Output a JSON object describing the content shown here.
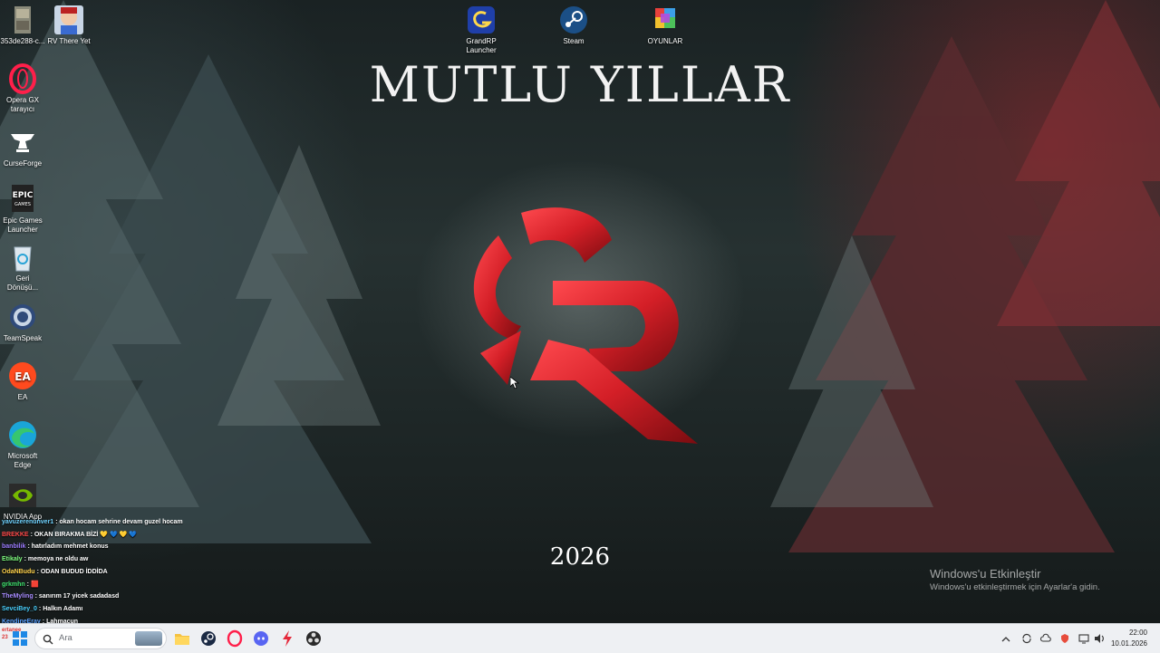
{
  "desktop": {
    "title": "MUTLU YILLAR",
    "year": "2026",
    "icons_left": [
      {
        "name": "file-icon",
        "label": "353de288-c..."
      },
      {
        "name": "rv-there-yet-icon",
        "label": "RV There Yet"
      },
      {
        "name": "opera-gx-icon",
        "label": "Opera GX\ntarayıcı"
      },
      {
        "name": "curseforge-icon",
        "label": "CurseForge"
      },
      {
        "name": "epic-games-icon",
        "label": "Epic Games\nLauncher"
      },
      {
        "name": "recycle-bin-icon",
        "label": "Geri\nDönüşü..."
      },
      {
        "name": "teamspeak-icon",
        "label": "TeamSpeak"
      },
      {
        "name": "ea-icon",
        "label": "EA"
      },
      {
        "name": "edge-icon",
        "label": "Microsoft\nEdge"
      },
      {
        "name": "nvidia-icon",
        "label": "NVIDIA App"
      }
    ],
    "icons_top": [
      {
        "name": "grandrp-icon",
        "label": "GrandRP\nLauncher"
      },
      {
        "name": "steam-icon",
        "label": "Steam"
      },
      {
        "name": "oyunlar-icon",
        "label": "OYUNLAR"
      }
    ]
  },
  "watermark": {
    "line1": "Windows'u Etkinleştir",
    "line2": "Windows'u etkinleştirmek için Ayarlar'a gidin."
  },
  "chat": [
    {
      "user": "yavuzerenunver1",
      "text": ": okan hocam sehrine devam guzel hocam",
      "color": "#6fd3ff"
    },
    {
      "user": "BREKKE",
      "text": ": OKAN BIRAKMA BİZİ 💛 💙 💛 💙",
      "color": "#ff4a4a"
    },
    {
      "user": "banbilik",
      "text": ": hatırladım mehmet konus",
      "color": "#9c7bff"
    },
    {
      "user": "Etikaly",
      "text": ": memoya ne oldu aw",
      "color": "#7fff7f"
    },
    {
      "user": "OdaNBudu",
      "text": ": ODAN BUDUD İDDİDA",
      "color": "#ffd24a"
    },
    {
      "user": "grkmhn",
      "text": ": 🟥",
      "color": "#3ee06d"
    },
    {
      "user": "TheMyling",
      "text": ": sanırım 17 yicek sadadasd",
      "color": "#a78bff"
    },
    {
      "user": "SevciBey_0",
      "text": ": Halkın Adamı",
      "color": "#4ad1ff"
    },
    {
      "user": "KendineEray",
      "text": ": Lahmacun",
      "color": "#5aa0ff"
    }
  ],
  "taskbar": {
    "search_placeholder": "Ara",
    "time": "22:00",
    "date": "10.01.2026",
    "badge_top": "ertanee",
    "badge_num": "23"
  },
  "colors": {
    "accent_red": "#d41f27",
    "taskbar_bg": "#eef0f3"
  }
}
